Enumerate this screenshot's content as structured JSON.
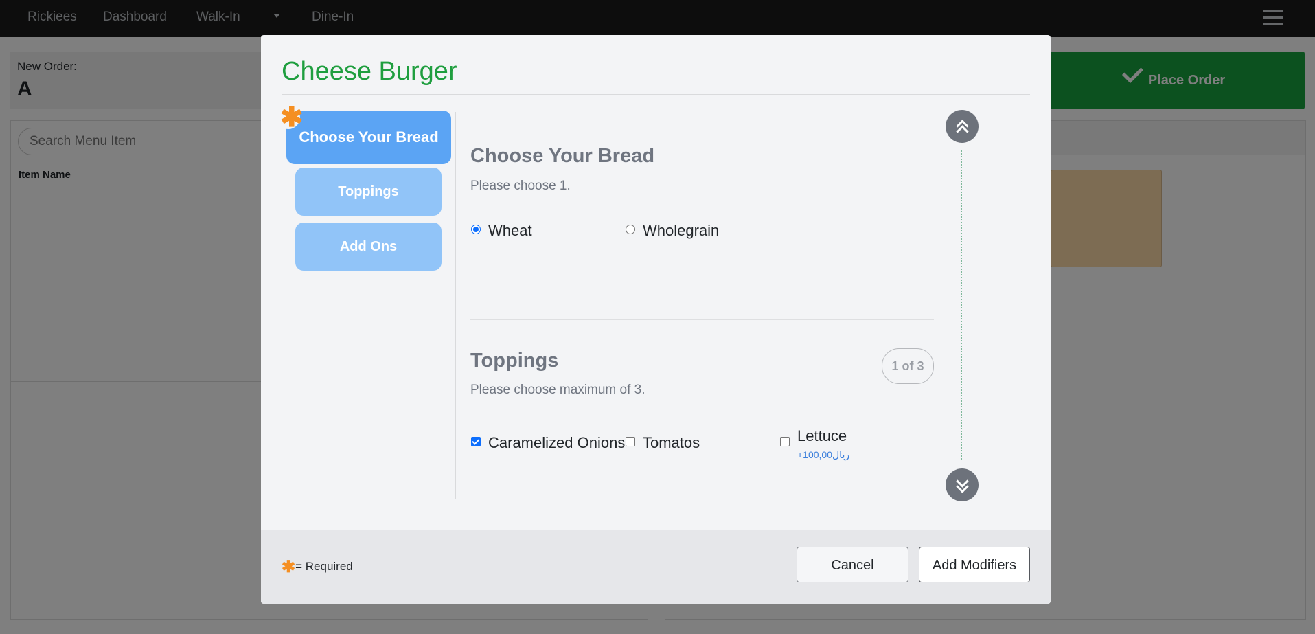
{
  "nav": {
    "brand": "Rickiees",
    "items": [
      "Dashboard",
      "Walk-In",
      "Dine-In"
    ]
  },
  "order": {
    "label": "New Order:",
    "value": "A"
  },
  "place_order_label": "Place Order",
  "menu": {
    "search_placeholder": "Search Menu Item",
    "column_header": "Item Name"
  },
  "modal": {
    "title": "Cheese Burger",
    "steps": [
      {
        "label": "Choose Your Bread",
        "active": true,
        "required": true
      },
      {
        "label": "Toppings",
        "active": false,
        "required": false
      },
      {
        "label": "Add Ons",
        "active": false,
        "required": false
      }
    ],
    "groups": [
      {
        "title": "Choose Your Bread",
        "subtitle": "Please choose 1.",
        "options": [
          {
            "label": "Wheat",
            "selected": true
          },
          {
            "label": "Wholegrain",
            "selected": false
          }
        ]
      },
      {
        "title": "Toppings",
        "subtitle": "Please choose maximum of 3.",
        "count_badge": "1 of 3",
        "options": [
          {
            "label": "Caramelized Onions",
            "checked": true
          },
          {
            "label": "Tomatos",
            "checked": false
          },
          {
            "label": "Lettuce",
            "checked": false,
            "price": "+100,00ريال"
          }
        ]
      }
    ],
    "footer": {
      "required_note": "= Required",
      "cancel_label": "Cancel",
      "add_label": "Add Modifiers"
    }
  },
  "colors": {
    "title_green": "#1f9e3f",
    "place_order_green": "#19a23f",
    "step_active": "#5ba4f4",
    "step_inactive": "#91c4f8",
    "required_star": "#f58f22",
    "price_blue": "#3b7fdc"
  },
  "icons": {
    "required": "asterisk-icon",
    "place_order": "check-icon",
    "scroll_up": "double-chevron-up-icon",
    "scroll_down": "double-chevron-down-icon",
    "menu": "hamburger-icon"
  }
}
